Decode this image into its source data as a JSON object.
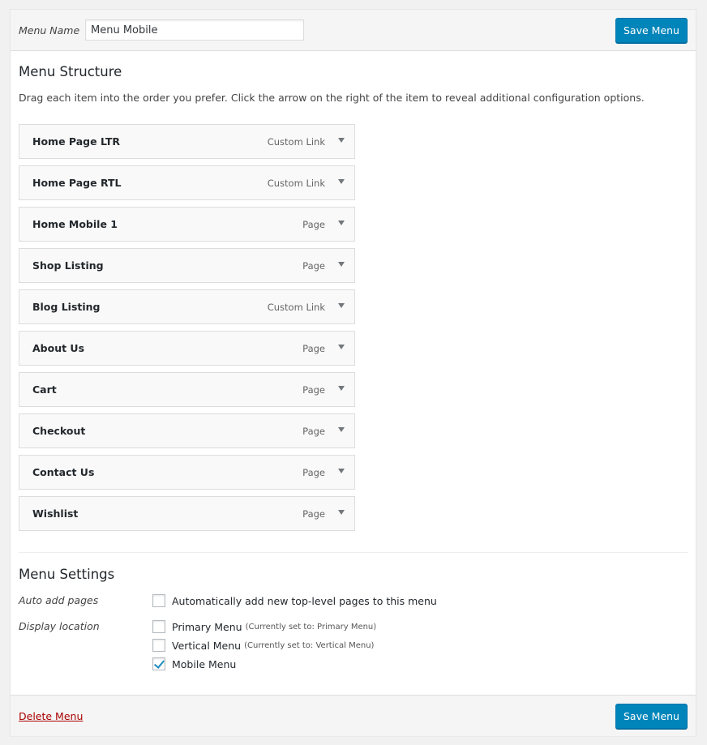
{
  "header": {
    "menu_name_label": "Menu Name",
    "menu_name_value": "Menu Mobile",
    "save_label": "Save Menu"
  },
  "structure": {
    "title": "Menu Structure",
    "instructions": "Drag each item into the order you prefer. Click the arrow on the right of the item to reveal additional configuration options.",
    "items": [
      {
        "title": "Home Page LTR",
        "type": "Custom Link"
      },
      {
        "title": "Home Page RTL",
        "type": "Custom Link"
      },
      {
        "title": "Home Mobile 1",
        "type": "Page"
      },
      {
        "title": "Shop Listing",
        "type": "Page"
      },
      {
        "title": "Blog Listing",
        "type": "Custom Link"
      },
      {
        "title": "About Us",
        "type": "Page"
      },
      {
        "title": "Cart",
        "type": "Page"
      },
      {
        "title": "Checkout",
        "type": "Page"
      },
      {
        "title": "Contact Us",
        "type": "Page"
      },
      {
        "title": "Wishlist",
        "type": "Page"
      }
    ]
  },
  "settings": {
    "title": "Menu Settings",
    "auto_add_label": "Auto add pages",
    "auto_add_text": "Automatically add new top-level pages to this menu",
    "auto_add_checked": false,
    "display_location_label": "Display location",
    "locations": [
      {
        "label": "Primary Menu",
        "note": "(Currently set to: Primary Menu)",
        "checked": false
      },
      {
        "label": "Vertical Menu",
        "note": "(Currently set to: Vertical Menu)",
        "checked": false
      },
      {
        "label": "Mobile Menu",
        "note": "",
        "checked": true
      }
    ]
  },
  "footer": {
    "delete_label": "Delete Menu",
    "save_label": "Save Menu"
  },
  "colors": {
    "primary_button": "#0085ba",
    "delete_link": "#aa0000",
    "checkmark": "#1e8cbe"
  }
}
